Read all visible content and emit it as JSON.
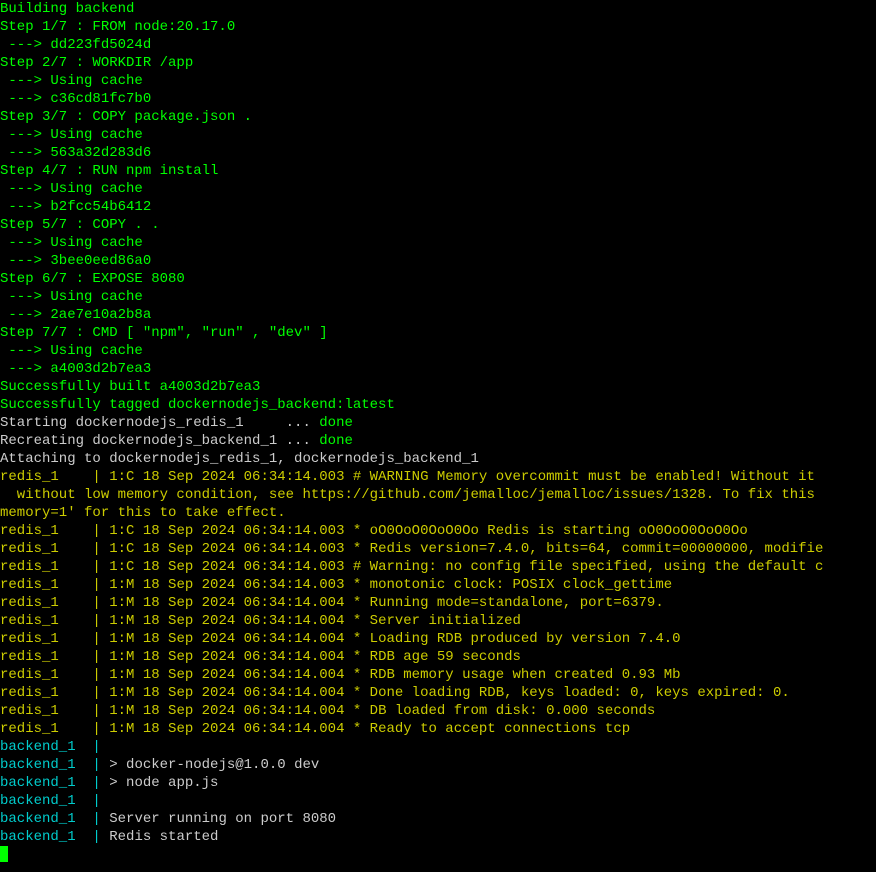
{
  "build": {
    "building": "Building backend",
    "step1": "Step 1/7 : FROM node:20.17.0",
    "step1_hash": " ---> dd223fd5024d",
    "step2": "Step 2/7 : WORKDIR /app",
    "cache1": " ---> Using cache",
    "step2_hash": " ---> c36cd81fc7b0",
    "step3": "Step 3/7 : COPY package.json .",
    "cache2": " ---> Using cache",
    "step3_hash": " ---> 563a32d283d6",
    "step4": "Step 4/7 : RUN npm install",
    "cache3": " ---> Using cache",
    "step4_hash": " ---> b2fcc54b6412",
    "step5": "Step 5/7 : COPY . .",
    "cache4": " ---> Using cache",
    "step5_hash": " ---> 3bee0eed86a0",
    "step6": "Step 6/7 : EXPOSE 8080",
    "cache5": " ---> Using cache",
    "step6_hash": " ---> 2ae7e10a2b8a",
    "step7": "Step 7/7 : CMD [ \"npm\", \"run\" , \"dev\" ]",
    "cache6": " ---> Using cache",
    "step7_hash": " ---> a4003d2b7ea3",
    "success_built": "Successfully built a4003d2b7ea3",
    "success_tagged": "Successfully tagged dockernodejs_backend:latest"
  },
  "starting": {
    "redis_prefix": "Starting dockernodejs_redis_1     ... ",
    "redis_done": "done",
    "backend_prefix": "Recreating dockernodejs_backend_1 ... ",
    "backend_done": "done",
    "attaching": "Attaching to dockernodejs_redis_1, dockernodejs_backend_1"
  },
  "redis": {
    "prefix": "redis_1    ",
    "pipe": "| ",
    "warning_overcommit": "1:C 18 Sep 2024 06:34:14.003 # WARNING Memory overcommit must be enabled! Without it",
    "warning_line2": "  without low memory condition, see https://github.com/jemalloc/jemalloc/issues/1328. To fix this ",
    "warning_line3": "memory=1' for this to take effect.",
    "starting": "1:C 18 Sep 2024 06:34:14.003 * oO0OoO0OoO0Oo Redis is starting oO0OoO0OoO0Oo",
    "version": "1:C 18 Sep 2024 06:34:14.003 * Redis version=7.4.0, bits=64, commit=00000000, modifie",
    "config_warning": "1:C 18 Sep 2024 06:34:14.003 # Warning: no config file specified, using the default c",
    "clock": "1:M 18 Sep 2024 06:34:14.003 * monotonic clock: POSIX clock_gettime",
    "running_mode": "1:M 18 Sep 2024 06:34:14.004 * Running mode=standalone, port=6379.",
    "server_init": "1:M 18 Sep 2024 06:34:14.004 * Server initialized",
    "loading_rdb": "1:M 18 Sep 2024 06:34:14.004 * Loading RDB produced by version 7.4.0",
    "rdb_age": "1:M 18 Sep 2024 06:34:14.004 * RDB age 59 seconds",
    "rdb_memory": "1:M 18 Sep 2024 06:34:14.004 * RDB memory usage when created 0.93 Mb",
    "done_loading": "1:M 18 Sep 2024 06:34:14.004 * Done loading RDB, keys loaded: 0, keys expired: 0.",
    "db_loaded": "1:M 18 Sep 2024 06:34:14.004 * DB loaded from disk: 0.000 seconds",
    "ready": "1:M 18 Sep 2024 06:34:14.004 * Ready to accept connections tcp"
  },
  "backend": {
    "prefix": "backend_1  ",
    "pipe": "| ",
    "empty": "",
    "dev": "> docker-nodejs@1.0.0 dev",
    "node": "> node app.js",
    "server": "Server running on port 8080",
    "redis_started": "Redis started"
  }
}
